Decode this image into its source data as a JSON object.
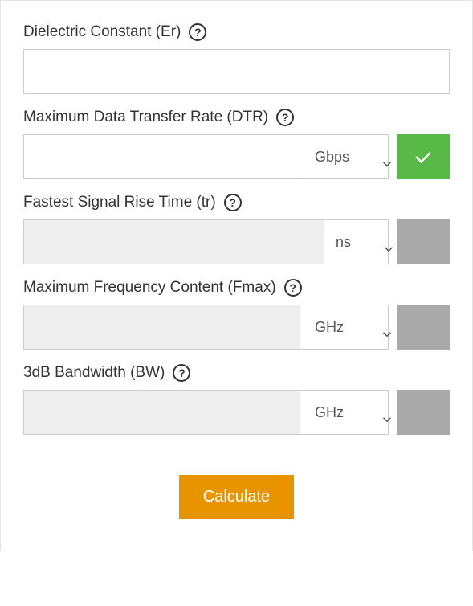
{
  "fields": {
    "er": {
      "label": "Dielectric Constant (Er)",
      "value": ""
    },
    "dtr": {
      "label": "Maximum Data Transfer Rate (DTR)",
      "value": "",
      "unit": "Gbps",
      "enabled": true,
      "selected": true
    },
    "tr": {
      "label": "Fastest Signal Rise Time (tr)",
      "value": "",
      "unit": "ns",
      "enabled": false,
      "selected": false
    },
    "fmax": {
      "label": "Maximum Frequency Content (Fmax)",
      "value": "",
      "unit": "GHz",
      "enabled": false,
      "selected": false
    },
    "bw": {
      "label": "3dB Bandwidth (BW)",
      "value": "",
      "unit": "GHz",
      "enabled": false,
      "selected": false
    }
  },
  "calculate_label": "Calculate",
  "help_glyph": "?"
}
